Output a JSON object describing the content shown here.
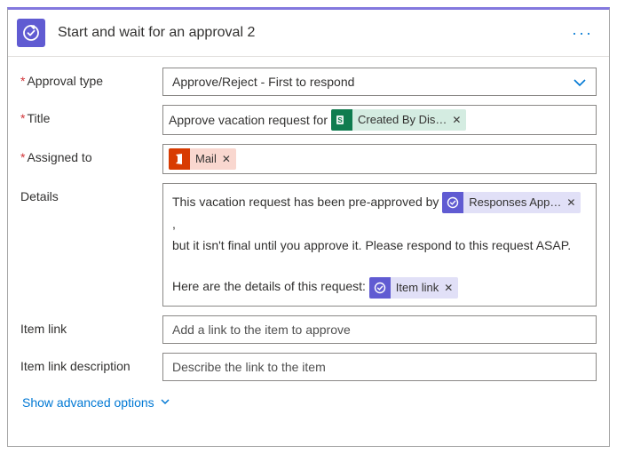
{
  "header": {
    "title": "Start and wait for an approval 2"
  },
  "labels": {
    "approval_type": "Approval type",
    "title": "Title",
    "assigned_to": "Assigned to",
    "details": "Details",
    "item_link": "Item link",
    "item_link_desc": "Item link description"
  },
  "approval_type": {
    "selected": "Approve/Reject - First to respond"
  },
  "title_field": {
    "prefix_text": "Approve vacation request for",
    "token": {
      "label": "Created By Dis…"
    }
  },
  "assigned_to": {
    "token": {
      "label": "Mail"
    }
  },
  "details": {
    "line1_before": "This vacation request has been pre-approved by ",
    "token1": {
      "label": "Responses App…"
    },
    "line1_after": " ,",
    "line2": "but it isn't final until you approve it. Please respond to this request ASAP.",
    "line3_before": "Here are the details of this request: ",
    "token2": {
      "label": "Item link"
    }
  },
  "item_link": {
    "placeholder": "Add a link to the item to approve",
    "value": ""
  },
  "item_link_desc": {
    "placeholder": "Describe the link to the item",
    "value": ""
  },
  "advanced_link": "Show advanced options"
}
